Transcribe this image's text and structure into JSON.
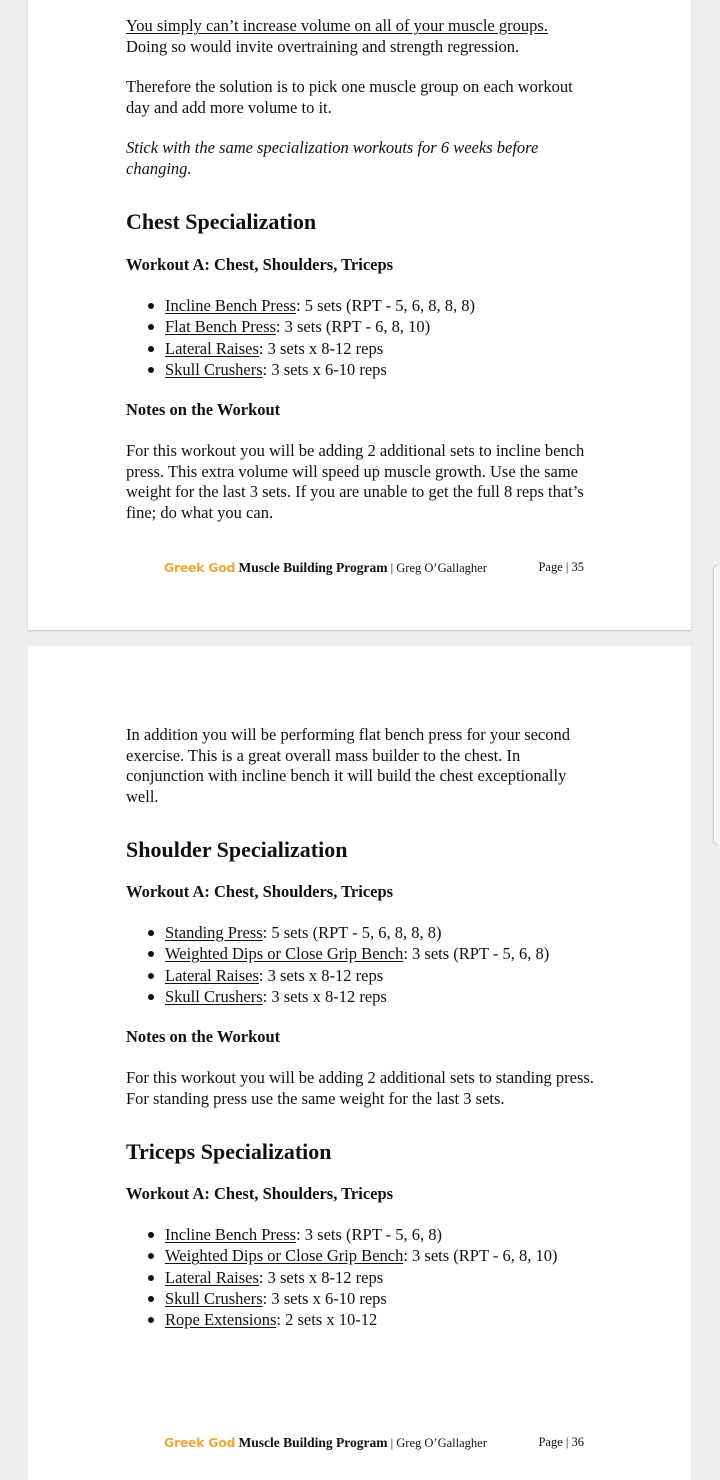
{
  "page1": {
    "intro_underlined": "You simply can’t increase volume on all of your muscle groups.",
    "intro_rest": "Doing so would invite overtraining and strength regression.",
    "solution": "Therefore the solution is to pick one muscle group on each workout day and add more volume to it.",
    "stick_note": "Stick with the same specialization workouts for 6 weeks before changing.",
    "section_title": "Chest Specialization",
    "workout_title": "Workout A: Chest, Shoulders, Triceps",
    "exercises": [
      {
        "name": "Incline Bench Press",
        "detail": ": 5 sets (RPT - 5, 6, 8, 8, 8)"
      },
      {
        "name": "Flat Bench Press",
        "detail": ": 3 sets (RPT - 6, 8, 10)"
      },
      {
        "name": "Lateral Raises",
        "detail": ": 3 sets x 8-12 reps"
      },
      {
        "name": "Skull Crushers",
        "detail": ": 3 sets x 6-10 reps"
      }
    ],
    "notes_title": "Notes on the Workout",
    "notes_text": "For this workout you will be adding 2 additional sets to incline bench press. This extra volume will speed up muscle growth. Use the same weight for the last 3 sets. If you are unable to get the full 8 reps that’s fine; do what you can.",
    "footer": {
      "brand": "Greek God",
      "program": "Muscle Building Program",
      "author": " | Greg O’Gallagher",
      "page": "Page | 35"
    }
  },
  "page2": {
    "intro": "In addition you will be performing flat bench press for your second exercise. This is a great overall mass builder to the chest. In conjunction with incline bench it will build the chest exceptionally well.",
    "shoulder": {
      "title": "Shoulder Specialization",
      "workout_title": "Workout A: Chest, Shoulders, Triceps",
      "exercises": [
        {
          "name": "Standing Press",
          "detail": ": 5 sets (RPT - 5, 6, 8, 8, 8)"
        },
        {
          "name": "Weighted Dips or Close Grip Bench",
          "detail": ": 3 sets (RPT - 5, 6, 8)"
        },
        {
          "name": "Lateral Raises",
          "detail": ": 3 sets x 8-12 reps"
        },
        {
          "name": "Skull Crushers",
          "detail": ": 3 sets x 8-12 reps"
        }
      ],
      "notes_title": "Notes on the Workout",
      "notes_text": "For this workout you will be adding 2 additional sets to standing press. For standing press use the same weight for the last 3 sets."
    },
    "triceps": {
      "title": "Triceps Specialization",
      "workout_title": "Workout A: Chest, Shoulders, Triceps",
      "exercises": [
        {
          "name": "Incline Bench Press",
          "detail": ": 3 sets (RPT - 5, 6, 8)"
        },
        {
          "name": "Weighted Dips or Close Grip Bench",
          "detail": ": 3 sets (RPT - 6, 8, 10)"
        },
        {
          "name": "Lateral Raises",
          "detail": ": 3 sets x 8-12 reps"
        },
        {
          "name": "Skull Crushers",
          "detail": ": 3 sets x 6-10 reps"
        },
        {
          "name": "Rope Extensions",
          "detail": ": 2 sets x 10-12"
        }
      ]
    },
    "footer": {
      "brand": "Greek God",
      "program": "Muscle Building Program",
      "author": " | Greg O’Gallagher",
      "page": "Page | 36"
    }
  },
  "colors": {
    "brand": "#f0a73a",
    "page_bg": "#ffffff",
    "viewer_bg": "#eeeeee"
  }
}
